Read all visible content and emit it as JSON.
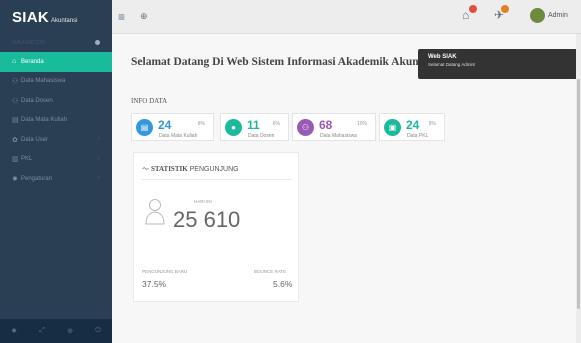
{
  "brand": {
    "name": "SIAK",
    "sub": "Akuntansi"
  },
  "sidebar": {
    "header": "NAVIGATION",
    "items": [
      {
        "label": "Beranda",
        "icon": "home-icon",
        "active": true
      },
      {
        "label": "Data Mahasiswa",
        "icon": "user-icon"
      },
      {
        "label": "Data Dosen",
        "icon": "user-icon"
      },
      {
        "label": "Data Mata Kuliah",
        "icon": "book-icon"
      },
      {
        "label": "Data User",
        "icon": "gear-icon",
        "chevron": true
      },
      {
        "label": "PKL",
        "icon": "building-icon",
        "chevron": true
      },
      {
        "label": "Pengaturan",
        "icon": "settings-icon",
        "chevron": true
      }
    ]
  },
  "topbar": {
    "user": "Admin"
  },
  "main": {
    "welcome": "Selamat Datang Di Web Sistem Informasi Akademik Akuntansi",
    "tooltip": {
      "title": "Web SIAK",
      "text": "Selamat Datang Admin!"
    },
    "info_title": "INFO DATA",
    "cards": [
      {
        "num": "24",
        "pct": "8%",
        "label": "Data Mata Kuliah"
      },
      {
        "num": "11",
        "pct": "6%",
        "label": "Data Dosen"
      },
      {
        "num": "68",
        "pct": "10%",
        "label": "Data Mahasiswa"
      },
      {
        "num": "24",
        "pct": "8%",
        "label": "Data PKL"
      }
    ],
    "stats": {
      "title_bold": "STATISTIK",
      "title_rest": " PENGUNJUNG",
      "hari_label": "HARI INI",
      "hari_value": "25 610",
      "new_label": "PENGUNJUNG BARU",
      "new_value": "37.5%",
      "bounce_label": "BOUNCE RATE",
      "bounce_value": "5.6%"
    }
  },
  "colors": {
    "sidebar": "#2a3f54",
    "accent": "#1abb9c",
    "blue": "#3498db",
    "purple": "#9b59b6"
  }
}
